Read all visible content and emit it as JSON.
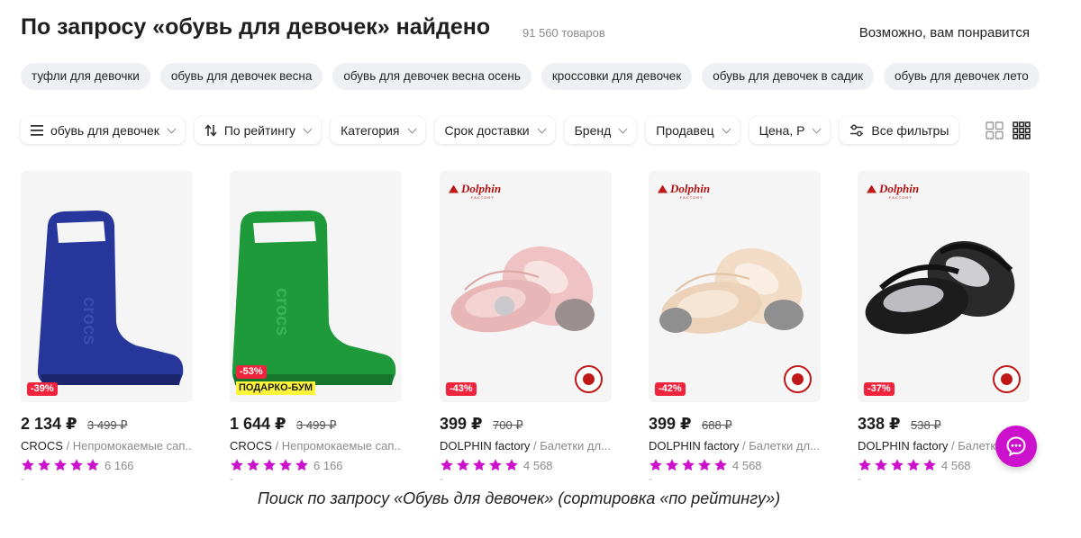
{
  "header": {
    "title": "По запросу «обувь для девочек» найдено",
    "count": "91 560 товаров",
    "recommend": "Возможно, вам понравится"
  },
  "chips": [
    "туфли для девочки",
    "обувь для девочек весна",
    "обувь для девочек весна осень",
    "кроссовки для девочек",
    "обувь для девочек в садик",
    "обувь для девочек лето"
  ],
  "filters": {
    "query": "обувь для девочек",
    "sort": "По рейтингу",
    "category": "Категория",
    "delivery": "Срок доставки",
    "brand": "Бренд",
    "seller": "Продавец",
    "price": "Цена, Р",
    "all": "Все фильтры"
  },
  "products": [
    {
      "price": "2 134 ₽",
      "old_price": "3 499 ₽",
      "discount": "-39%",
      "brand": "CROCS",
      "name": "Непромокаемые сап...",
      "reviews": "6 166",
      "rating": 5,
      "dash": "-"
    },
    {
      "price": "1 644 ₽",
      "old_price": "3 499 ₽",
      "discount": "-53%",
      "promo": "ПОДАРКО-БУМ",
      "brand": "CROCS",
      "name": "Непромокаемые сап...",
      "reviews": "6 166",
      "rating": 5,
      "dash": "-"
    },
    {
      "price": "399 ₽",
      "old_price": "700 ₽",
      "discount": "-43%",
      "brand": "DOLPHIN factory",
      "name": "Балетки дл...",
      "reviews": "4 568",
      "rating": 5,
      "dash": "-",
      "logo": "Dolphin",
      "logo_sub": "FACTORY"
    },
    {
      "price": "399 ₽",
      "old_price": "688 ₽",
      "discount": "-42%",
      "brand": "DOLPHIN factory",
      "name": "Балетки дл...",
      "reviews": "4 568",
      "rating": 5,
      "dash": "-",
      "logo": "Dolphin",
      "logo_sub": "FACTORY"
    },
    {
      "price": "338 ₽",
      "old_price": "538 ₽",
      "discount": "-37%",
      "brand": "DOLPHIN factory",
      "name": "Балетки дл...",
      "reviews": "4 568",
      "rating": 5,
      "dash": "-",
      "logo": "Dolphin",
      "logo_sub": "FACTORY"
    }
  ],
  "caption": "Поиск по запросу «Обувь для девочек» (сортировка «по рейтингу»)",
  "colors": {
    "accent": "#cc11cc",
    "star": "#cc11cc",
    "discount": "#f0243c",
    "promo": "#fff53a",
    "chip_bg": "#eef0f3",
    "boot_blue": "#27369a",
    "boot_green": "#1f9a3a",
    "ballet_pink": "#efc3c3",
    "ballet_beige": "#f2dcc6",
    "ballet_black": "#1c1c1c",
    "sole_grey": "#8f8f8f",
    "logo_red": "#c01818"
  },
  "icons": {
    "query_filter": "hamburger-icon",
    "sort": "sort-arrows-icon",
    "all_filters": "sliders-icon",
    "view_large": "grid-2x2-icon",
    "view_small": "grid-3x3-icon",
    "chat": "chat-bubble-icon",
    "rating": "star-icon"
  }
}
